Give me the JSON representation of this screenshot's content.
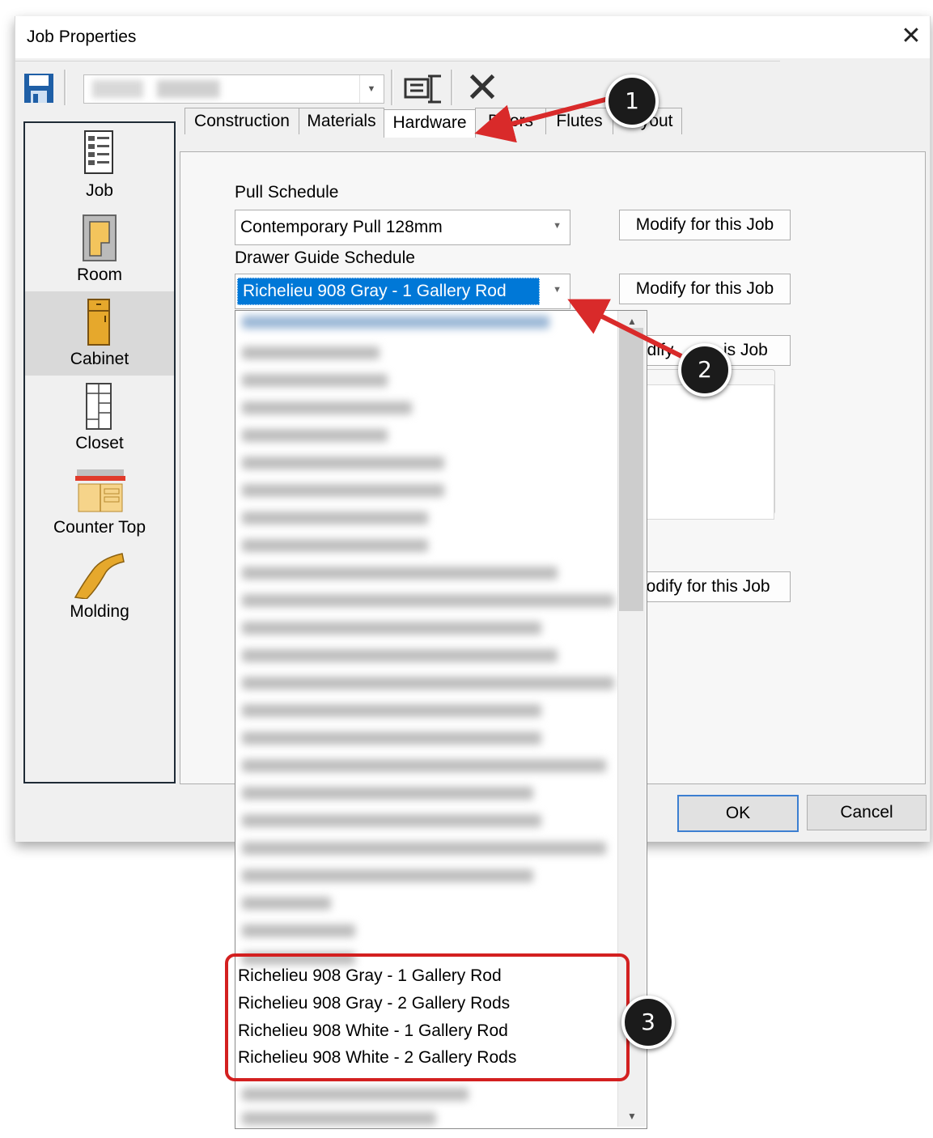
{
  "window": {
    "title": "Job Properties",
    "close_glyph": "✕"
  },
  "toolbar": {
    "icons": [
      "save-icon",
      "properties-icon",
      "delete-icon"
    ],
    "combo_value": ""
  },
  "sidebar": {
    "items": [
      {
        "label": "Job",
        "icon": "job-icon"
      },
      {
        "label": "Room",
        "icon": "room-icon"
      },
      {
        "label": "Cabinet",
        "icon": "cabinet-icon",
        "selected": true
      },
      {
        "label": "Closet",
        "icon": "closet-icon"
      },
      {
        "label": "Counter Top",
        "icon": "counter-top-icon"
      },
      {
        "label": "Molding",
        "icon": "molding-icon"
      }
    ]
  },
  "tabs": [
    {
      "label": "Construction"
    },
    {
      "label": "Materials"
    },
    {
      "label": "Hardware",
      "active": true
    },
    {
      "label": "Doors"
    },
    {
      "label": "Flutes"
    },
    {
      "label": "Layout"
    }
  ],
  "hardware": {
    "pull_schedule_label": "Pull Schedule",
    "pull_schedule_value": "Contemporary Pull 128mm",
    "drawer_guide_label": "Drawer Guide Schedule",
    "drawer_guide_value": "Richelieu 908 Gray - 1 Gallery Rod",
    "modify_button": "Modify for this Job",
    "modify_partial_3": "odify",
    "modify_partial_3b": "is Job",
    "modify_partial_4": "lodify for this Job"
  },
  "dropdown_list": {
    "visible_items": [
      "Richelieu 908 Gray - 1 Gallery Rod",
      "Richelieu 908 Gray - 2 Gallery Rods",
      "Richelieu 908 White - 1 Gallery Rod",
      "Richelieu 908 White - 2 Gallery Rods"
    ]
  },
  "footer": {
    "ok_label": "OK",
    "cancel_label": "Cancel"
  },
  "annotations": {
    "callouts": [
      "1",
      "2",
      "3"
    ],
    "highlight_color": "#d32020"
  },
  "colors": {
    "selection": "#0078d7",
    "ok_border": "#3c7fd1",
    "sidebar_border": "#1f2b36"
  }
}
